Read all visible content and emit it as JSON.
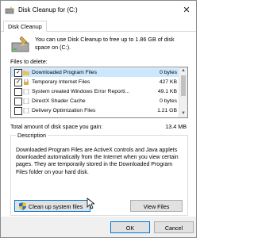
{
  "window": {
    "title": "Disk Cleanup for  (C:)"
  },
  "tabs": [
    {
      "label": "Disk Cleanup"
    }
  ],
  "intro": "You can use Disk Cleanup to free up to 1.86 GB of disk space on  (C:).",
  "files_label": "Files to delete:",
  "files": [
    {
      "name": "Downloaded Program Files",
      "size": "0 bytes",
      "checked": true,
      "selected": true
    },
    {
      "name": "Temporary Internet Files",
      "size": "427 KB",
      "checked": true,
      "selected": false
    },
    {
      "name": "System created Windows Error Reporti...",
      "size": "49.1 KB",
      "checked": false,
      "selected": false
    },
    {
      "name": "DirectX Shader Cache",
      "size": "0 bytes",
      "checked": false,
      "selected": false
    },
    {
      "name": "Delivery Optimization Files",
      "size": "1.21 GB",
      "checked": false,
      "selected": false
    }
  ],
  "total": {
    "label": "Total amount of disk space you gain:",
    "value": "13.4 MB"
  },
  "description": {
    "legend": "Description",
    "text": "Downloaded Program Files are ActiveX controls and Java applets downloaded automatically from the Internet when you view certain pages. They are temporarily stored in the Downloaded Program Files folder on your hard disk."
  },
  "buttons": {
    "cleanup_system": "Clean up system files",
    "view_files": "View Files",
    "ok": "OK",
    "cancel": "Cancel"
  },
  "colors": {
    "selection": "#cce8ff",
    "focus_border": "#0078d7",
    "button_bg": "#e1e1e1"
  }
}
